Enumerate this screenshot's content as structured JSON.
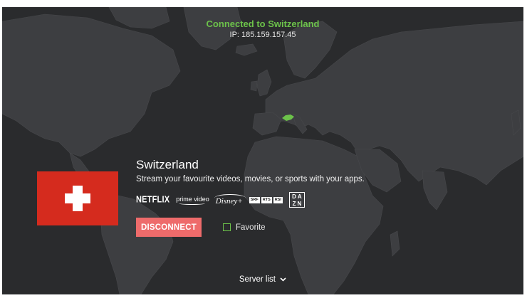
{
  "status": {
    "connected_text": "Connected to Switzerland",
    "ip_text": "IP: 185.159.157.45"
  },
  "location": {
    "country": "Switzerland",
    "tagline": "Stream your favourite videos, movies, or sports with your apps.",
    "flag_icon": "swiss-flag",
    "highlight_color": "#6cc24a"
  },
  "apps": {
    "netflix": "NETFLIX",
    "prime": "prime video",
    "disney": "Disney+",
    "srg": [
      "SRF",
      "RTS",
      "RSI"
    ],
    "dazn_top": "DA",
    "dazn_bottom": "ZN"
  },
  "actions": {
    "disconnect_label": "DISCONNECT",
    "favorite_label": "Favorite",
    "favorite_checked": false
  },
  "footer": {
    "server_list_label": "Server list",
    "server_list_icon": "chevron-down-icon"
  },
  "colors": {
    "background": "#2a2b2d",
    "land": "#3d3e41",
    "accent_green": "#6cc24a",
    "disconnect_red": "#ee6b6b",
    "flag_red": "#d52b1e"
  }
}
